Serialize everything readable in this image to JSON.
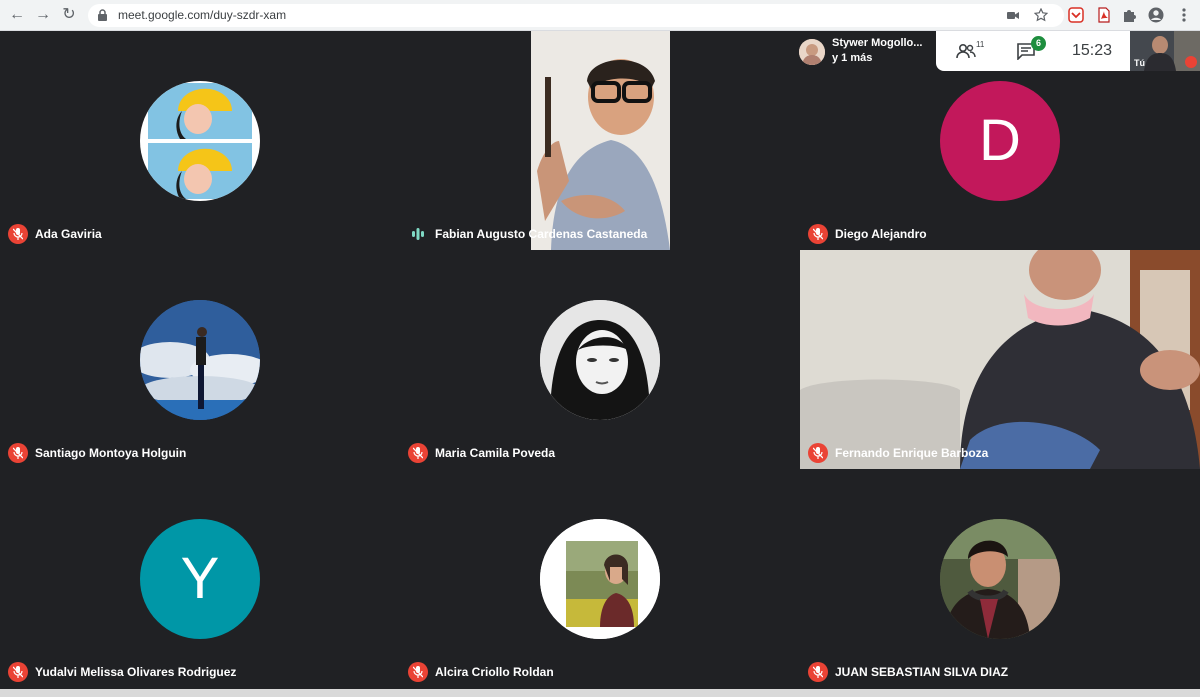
{
  "browser": {
    "url": "meet.google.com/duy-szdr-xam"
  },
  "meeting": {
    "presenter_name": "Stywer Mogollo...",
    "presenter_more": "y 1 más",
    "people_count": "11",
    "chat_badge": "6",
    "time": "15:23",
    "self_label": "Tú"
  },
  "tiles": [
    {
      "name": "Ada Gaviria",
      "type": "photo",
      "muted": true
    },
    {
      "name": "Fabian Augusto Cardenas Castaneda",
      "type": "video",
      "muted": false
    },
    {
      "name": "Diego Alejandro",
      "type": "letter",
      "letter": "D",
      "color": "#c2185b",
      "muted": true
    },
    {
      "name": "Santiago Montoya Holguin",
      "type": "photo",
      "muted": true
    },
    {
      "name": "Maria Camila Poveda",
      "type": "photo",
      "muted": true
    },
    {
      "name": "Fernando Enrique Barboza",
      "type": "video",
      "muted": true
    },
    {
      "name": "Yudalvi Melissa Olivares Rodriguez",
      "type": "letter",
      "letter": "Y",
      "color": "#0097a7",
      "muted": true
    },
    {
      "name": "Alcira Criollo Roldan",
      "type": "photo",
      "muted": true
    },
    {
      "name": "JUAN SEBASTIAN SILVA DIAZ",
      "type": "photo",
      "muted": true
    }
  ],
  "colors": {
    "background": "#202124",
    "mic_off": "#ea4335",
    "speaking": "#7fd9c4",
    "chat_badge": "#1e8e3e"
  }
}
